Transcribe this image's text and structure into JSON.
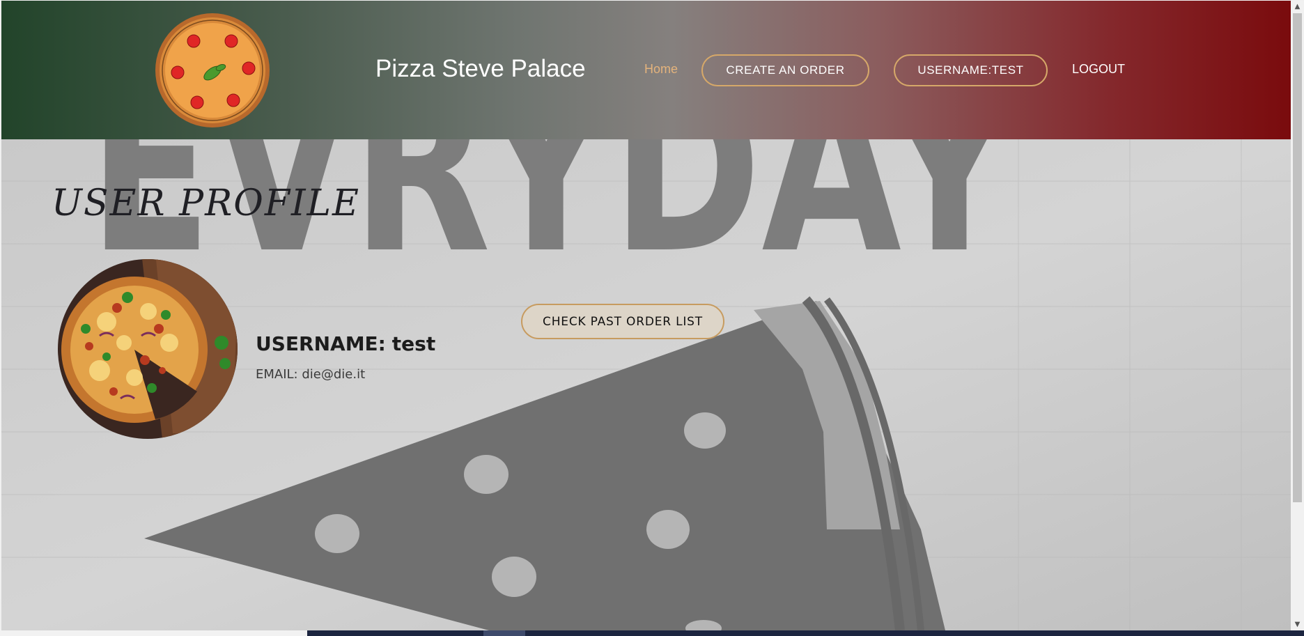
{
  "header": {
    "brand": "Pizza Steve Palace",
    "nav": {
      "home": "Home",
      "create_order": "CREATE AN ORDER",
      "username_button": "USERNAME:TEST",
      "logout": "LOGOUT"
    }
  },
  "background": {
    "wall_text": "EVRYDAY"
  },
  "profile": {
    "title": "USER PROFILE",
    "username_label": "USERNAME:",
    "username_value": "test",
    "email_label": "EMAIL:",
    "email_value": "die@die.it",
    "past_orders_button": "CHECK PAST ORDER LIST"
  },
  "colors": {
    "header_green": "#22442a",
    "header_red": "#7a0b0d",
    "accent_gold": "#d6a869",
    "home_link": "#e4b37c"
  },
  "icons": {
    "logo": "pizza-logo-icon",
    "avatar": "pizza-photo",
    "scroll_up": "chevron-up-icon",
    "scroll_down": "chevron-down-icon"
  }
}
